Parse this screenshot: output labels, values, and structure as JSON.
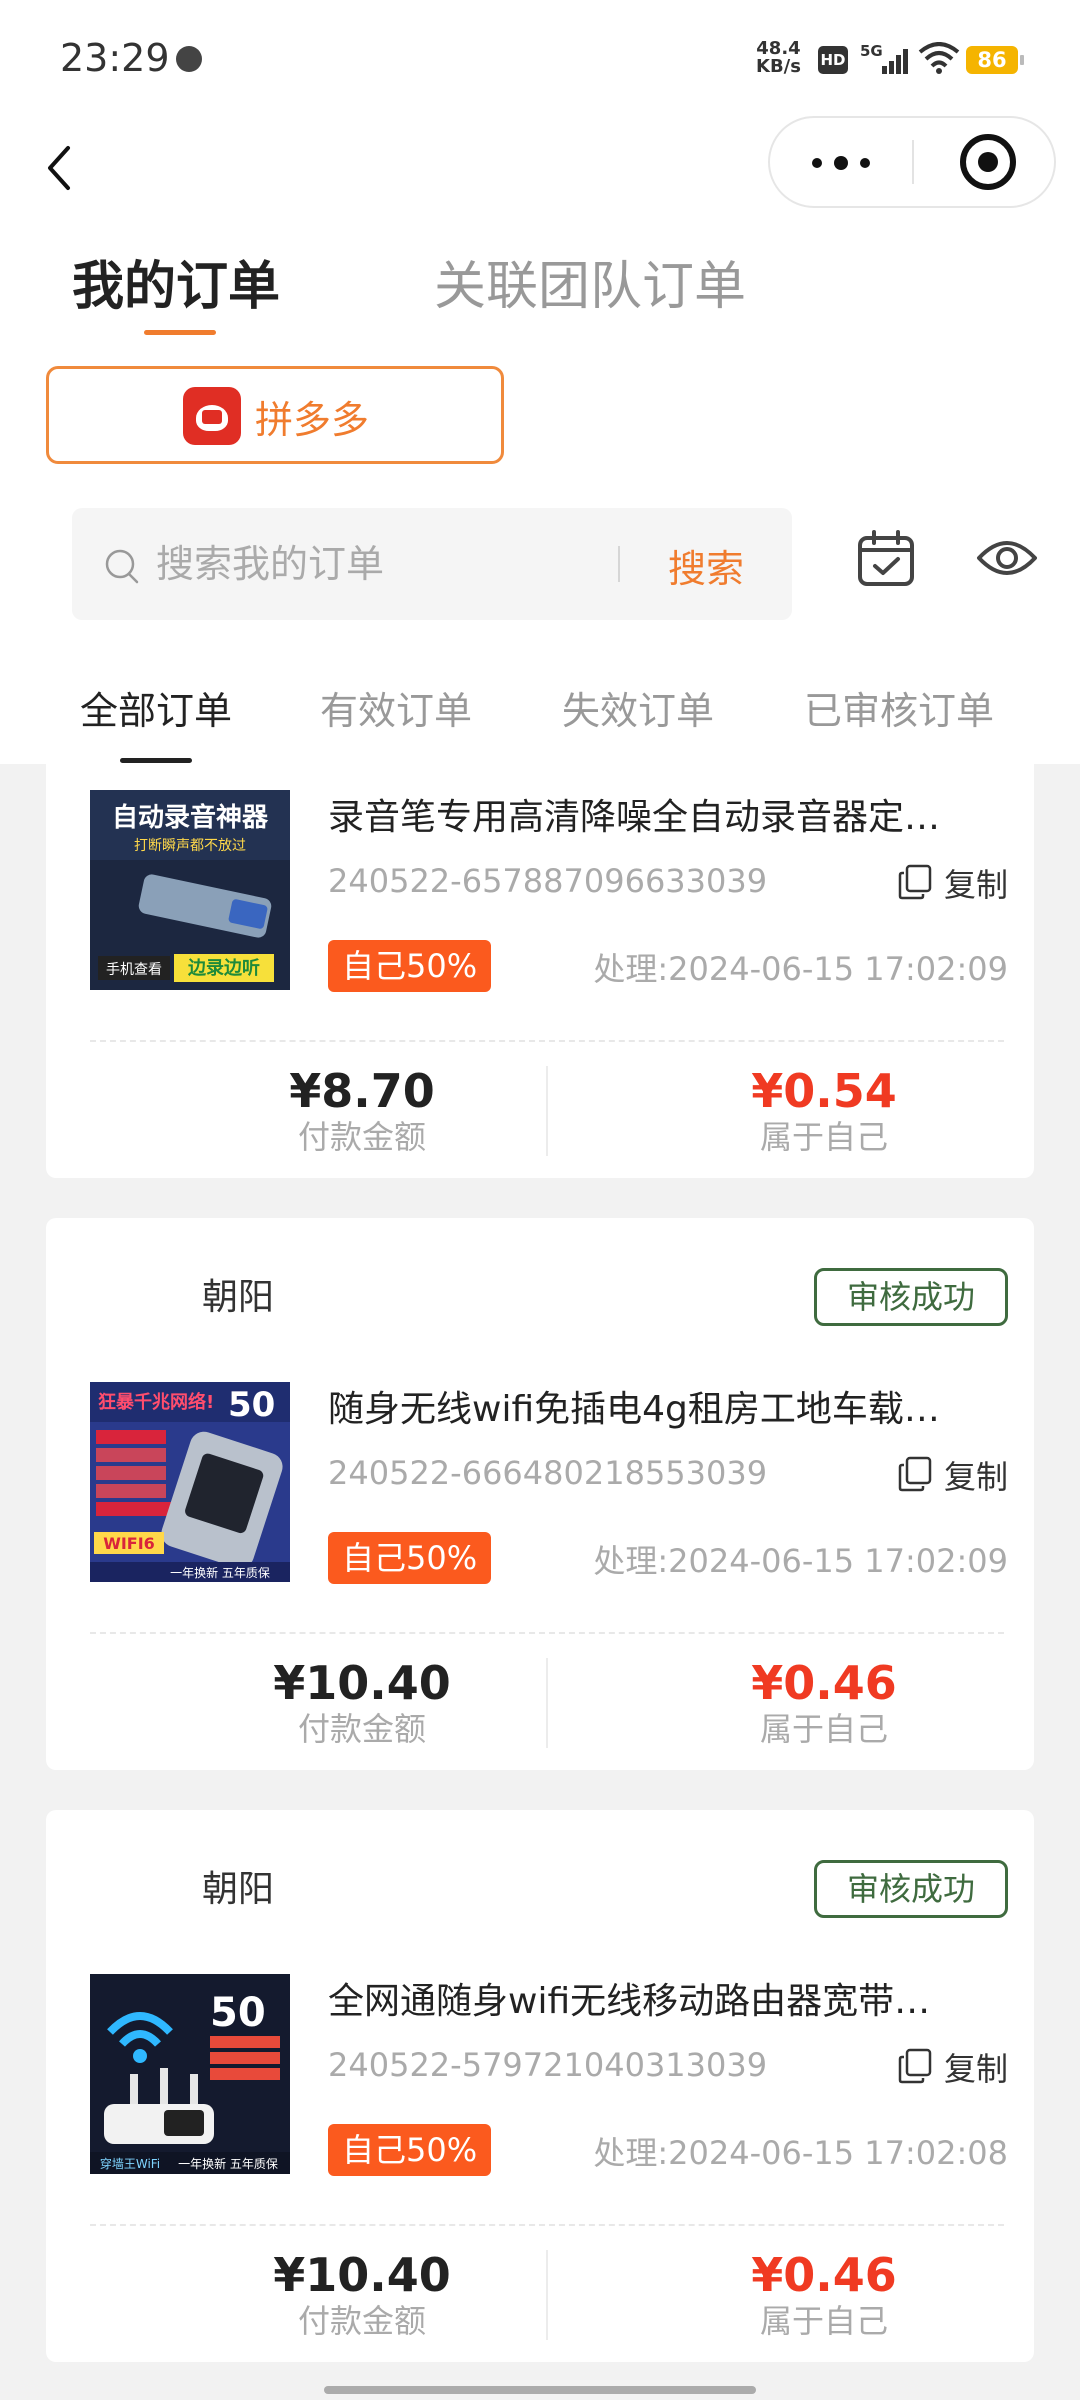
{
  "status_bar": {
    "time": "23:29",
    "net_speed_value": "48.4",
    "net_speed_unit": "KB/s",
    "hd": "HD",
    "network": "5G",
    "battery": "86"
  },
  "header": {
    "tabs": [
      "我的订单",
      "关联团队订单"
    ],
    "platform": "拼多多",
    "search": {
      "placeholder": "搜索我的订单",
      "button": "搜索"
    },
    "sub_tabs": [
      "全部订单",
      "有效订单",
      "失效订单",
      "已审核订单"
    ]
  },
  "labels": {
    "copy": "复制",
    "paid": "付款金额",
    "own": "属于自己"
  },
  "orders": [
    {
      "title": "录音笔专用高清降噪全自动录音器定…",
      "order_no": "240522-657887096633039",
      "share": "自己50%",
      "processed": "处理:2024-06-15 17:02:09",
      "paid": "¥8.70",
      "commission": "¥0.54",
      "thumb": {
        "line1": "自动录音神器",
        "line2": "打断瞬声都不放过",
        "tag1": "手机查看",
        "tag2": "边录边听"
      }
    },
    {
      "store": "朝阳",
      "status": "审核成功",
      "title": "随身无线wifi免插电4g租房工地车载…",
      "order_no": "240522-666480218553039",
      "share": "自己50%",
      "processed": "处理:2024-06-15 17:02:09",
      "paid": "¥10.40",
      "commission": "¥0.46",
      "thumb": {
        "line1": "狂暴千兆网络!",
        "speed": "50",
        "badge": "WIFI6",
        "foot": "一年换新 五年质保"
      }
    },
    {
      "store": "朝阳",
      "status": "审核成功",
      "title": "全网通随身wifi无线移动路由器宽带…",
      "order_no": "240522-579721040313039",
      "share": "自己50%",
      "processed": "处理:2024-06-15 17:02:08",
      "paid": "¥10.40",
      "commission": "¥0.46",
      "thumb": {
        "speed": "50",
        "brand": "穿墙王WiFi",
        "foot": "一年换新 五年质保"
      }
    }
  ],
  "colors": {
    "accent": "#f07c2e",
    "tag_bg": "#fb5a1e",
    "price_red": "#f03a22",
    "approved_green": "#3f6b3f"
  },
  "icons": [
    "back-arrow-icon",
    "more-dots-icon",
    "close-target-icon",
    "search-icon",
    "calendar-check-icon",
    "eye-icon",
    "copy-icon",
    "pinduoduo-logo"
  ]
}
